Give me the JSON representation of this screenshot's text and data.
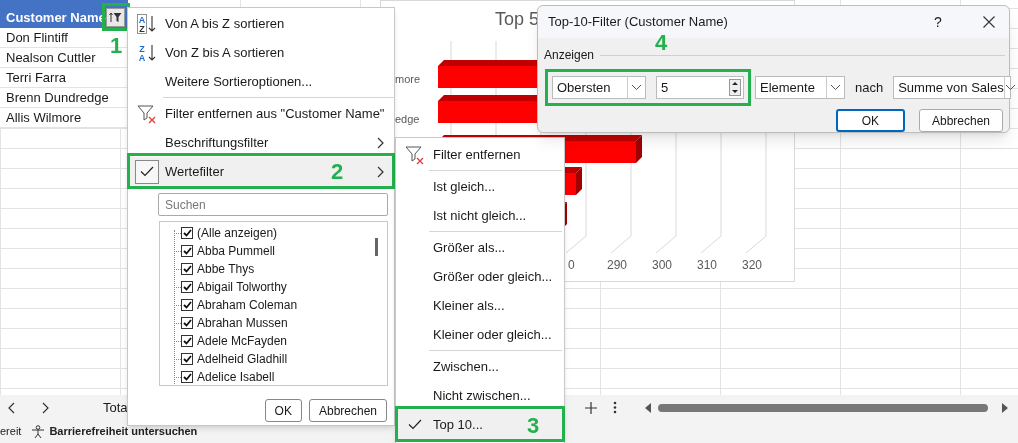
{
  "sheet": {
    "header": "Customer Name",
    "filter_annotation": "1",
    "rows": [
      "Don Flintiff",
      "Nealson Cuttler",
      "Terri Farra",
      "Brenn Dundredge",
      "Allis Wilmore"
    ]
  },
  "chart": {
    "title": "Top 5",
    "category_labels": [
      "more",
      "edge"
    ],
    "axis_labels": [
      "0",
      "290",
      "300",
      "310",
      "320"
    ]
  },
  "filter_menu": {
    "items": [
      {
        "kind": "sort_az",
        "label": "Von A bis Z sortieren",
        "icon_text": [
          "A",
          "Z"
        ],
        "selected": false,
        "checked": false
      },
      {
        "kind": "sort_za",
        "label": "Von Z bis A sortieren",
        "icon_text": [
          "Z",
          "A"
        ],
        "selected": false,
        "checked": false
      },
      {
        "kind": "text",
        "label": "Weitere Sortieroptionen...",
        "selected": false,
        "checked": false
      },
      {
        "kind": "separator"
      },
      {
        "kind": "clear_filter",
        "label": "Filter entfernen aus \"Customer Name\"",
        "selected": false,
        "checked": false
      },
      {
        "kind": "submenu",
        "label": "Beschriftungsfilter",
        "selected": false,
        "checked": false
      },
      {
        "kind": "submenu",
        "label": "Wertefilter",
        "selected": true,
        "checked": true,
        "annotation": "2"
      }
    ],
    "search": {
      "placeholder": "Suchen"
    },
    "list": [
      {
        "label": "(Alle anzeigen)",
        "checked": true
      },
      {
        "label": "Abba Pummell",
        "checked": true
      },
      {
        "label": "Abbe Thys",
        "checked": true
      },
      {
        "label": "Abigail Tolworthy",
        "checked": true
      },
      {
        "label": "Abraham Coleman",
        "checked": true
      },
      {
        "label": "Abrahan Mussen",
        "checked": true
      },
      {
        "label": "Adele McFayden",
        "checked": true
      },
      {
        "label": "Adelheid Gladhill",
        "checked": true
      },
      {
        "label": "Adelice Isabell",
        "checked": true
      }
    ],
    "buttons": [
      "OK",
      "Abbrechen"
    ]
  },
  "value_submenu": {
    "items": [
      {
        "kind": "clear_filter",
        "label": "Filter entfernen",
        "selected": false,
        "checked": false
      },
      {
        "kind": "separator"
      },
      {
        "kind": "text",
        "label": "Ist gleich...",
        "selected": false,
        "checked": false
      },
      {
        "kind": "text",
        "label": "Ist nicht gleich...",
        "selected": false,
        "checked": false
      },
      {
        "kind": "separator"
      },
      {
        "kind": "text",
        "label": "Größer als...",
        "selected": false,
        "checked": false
      },
      {
        "kind": "text",
        "label": "Größer oder gleich...",
        "selected": false,
        "checked": false
      },
      {
        "kind": "text",
        "label": "Kleiner als...",
        "selected": false,
        "checked": false
      },
      {
        "kind": "text",
        "label": "Kleiner oder gleich...",
        "selected": false,
        "checked": false
      },
      {
        "kind": "separator"
      },
      {
        "kind": "text",
        "label": "Zwischen...",
        "selected": false,
        "checked": false
      },
      {
        "kind": "text",
        "label": "Nicht zwischen...",
        "selected": false,
        "checked": false
      },
      {
        "kind": "text",
        "label": "Top 10...",
        "selected": true,
        "checked": true,
        "annotation": "3"
      }
    ]
  },
  "dialog": {
    "title": "Top-10-Filter (Customer Name)",
    "help": "?",
    "group_label": "Anzeigen",
    "annotation": "4",
    "direction": "Obersten",
    "count": "5",
    "unit": "Elemente",
    "by_label": "nach",
    "field": "Summe von Sales",
    "buttons": [
      {
        "label": "OK",
        "default": true
      },
      {
        "label": "Abbrechen",
        "default": false
      }
    ]
  },
  "sheet_tabs": {
    "tab": "Tota"
  },
  "status_bar": {
    "ready": "ereit",
    "accessibility": "Barrierefreiheit untersuchen"
  }
}
